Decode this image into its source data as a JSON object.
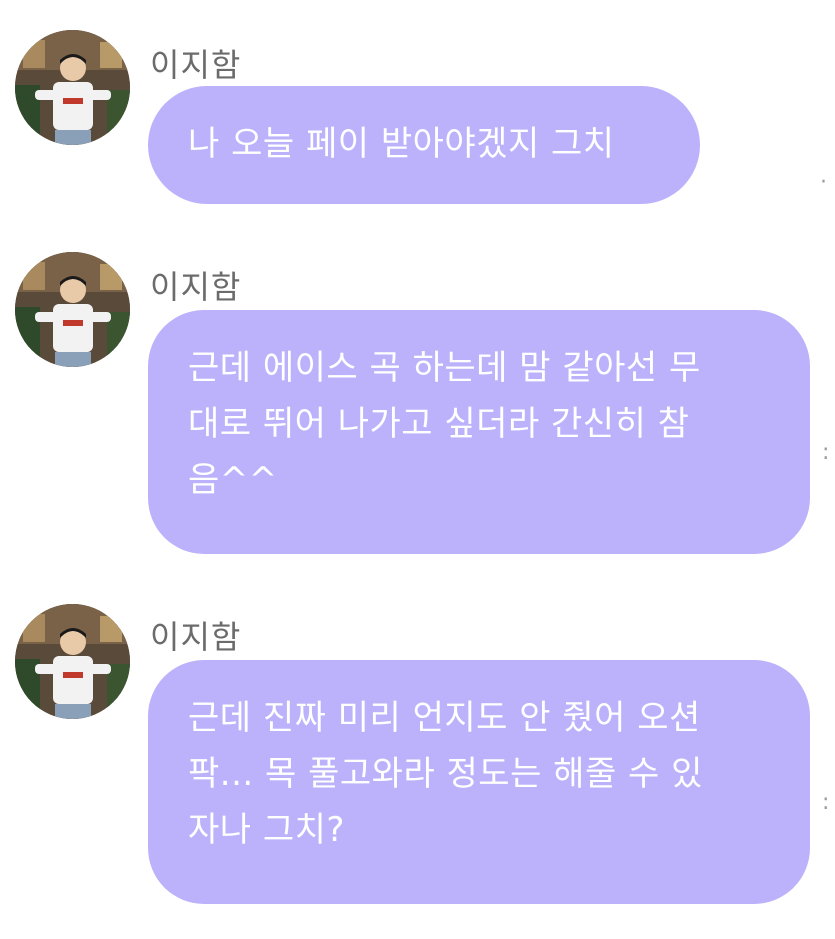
{
  "messages": [
    {
      "sender": "이지함",
      "text": "나 오늘 페이 받아야겠지 그치"
    },
    {
      "sender": "이지함",
      "text": "근데 에이스 곡 하는데 맘 같아선 무\n대로 뛰어 나가고 싶더라 간신히 참\n음^^"
    },
    {
      "sender": "이지함",
      "text": "근데 진짜 미리 언지도 안 줬어 오션\n팍... 목 풀고와라 정도는 해줄 수 있\n자나 그치?"
    }
  ],
  "colors": {
    "bubble": "#bcb2fb",
    "bubble_text": "#ffffff",
    "name_text": "#6b6b6b",
    "background": "#ffffff"
  },
  "icons": {
    "avatar": "profile-photo"
  }
}
